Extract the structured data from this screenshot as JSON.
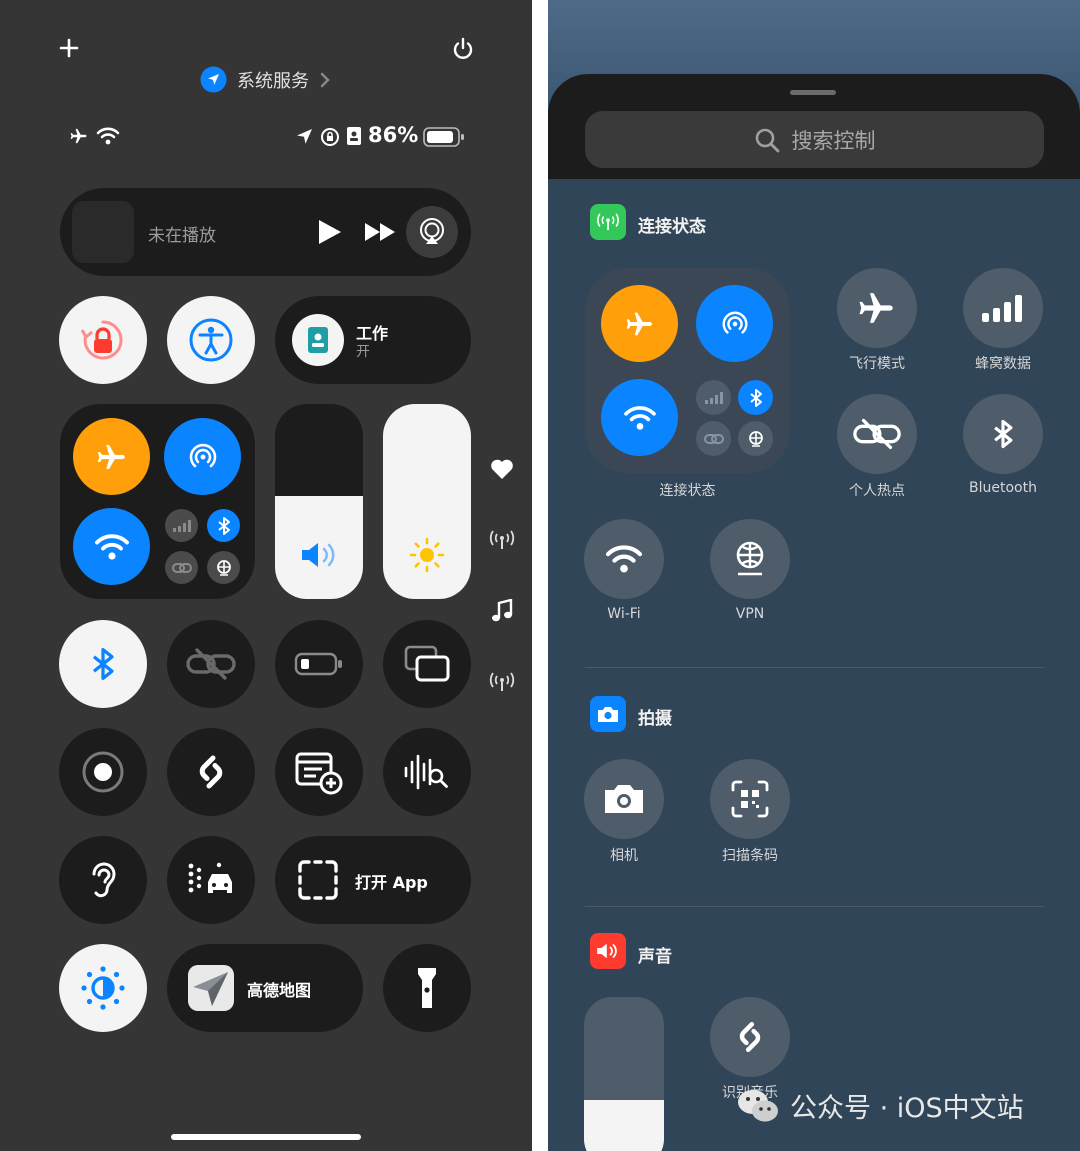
{
  "left": {
    "top": {
      "add_icon": "plus-icon",
      "power_icon": "power-icon",
      "location_label": "系统服务"
    },
    "status": {
      "battery": "86%"
    },
    "now_playing": {
      "label": "未在播放"
    },
    "focus": {
      "title": "工作",
      "subtitle": "开"
    },
    "open_app": {
      "label": "打开 App"
    },
    "amap": {
      "label": "高德地图"
    }
  },
  "right": {
    "search": {
      "placeholder": "搜索控制"
    },
    "connectivity": {
      "title": "连接状态",
      "group_label": "连接状态",
      "airplane": "飞行模式",
      "cellular": "蜂窝数据",
      "hotspot": "个人热点",
      "bluetooth": "Bluetooth",
      "wifi": "Wi-Fi",
      "vpn": "VPN"
    },
    "camera_section": {
      "title": "拍摄",
      "camera": "相机",
      "scan": "扫描条码"
    },
    "sound_section": {
      "title": "声音",
      "shazam": "识别音乐"
    },
    "watermark": "公众号 · iOS中文站"
  },
  "colors": {
    "orange": "#ff9f0a",
    "blue": "#0a84ff",
    "green": "#34c759",
    "red": "#ff3b30",
    "dark_bg": "#353535",
    "tile_dark": "#1c1c1c"
  }
}
